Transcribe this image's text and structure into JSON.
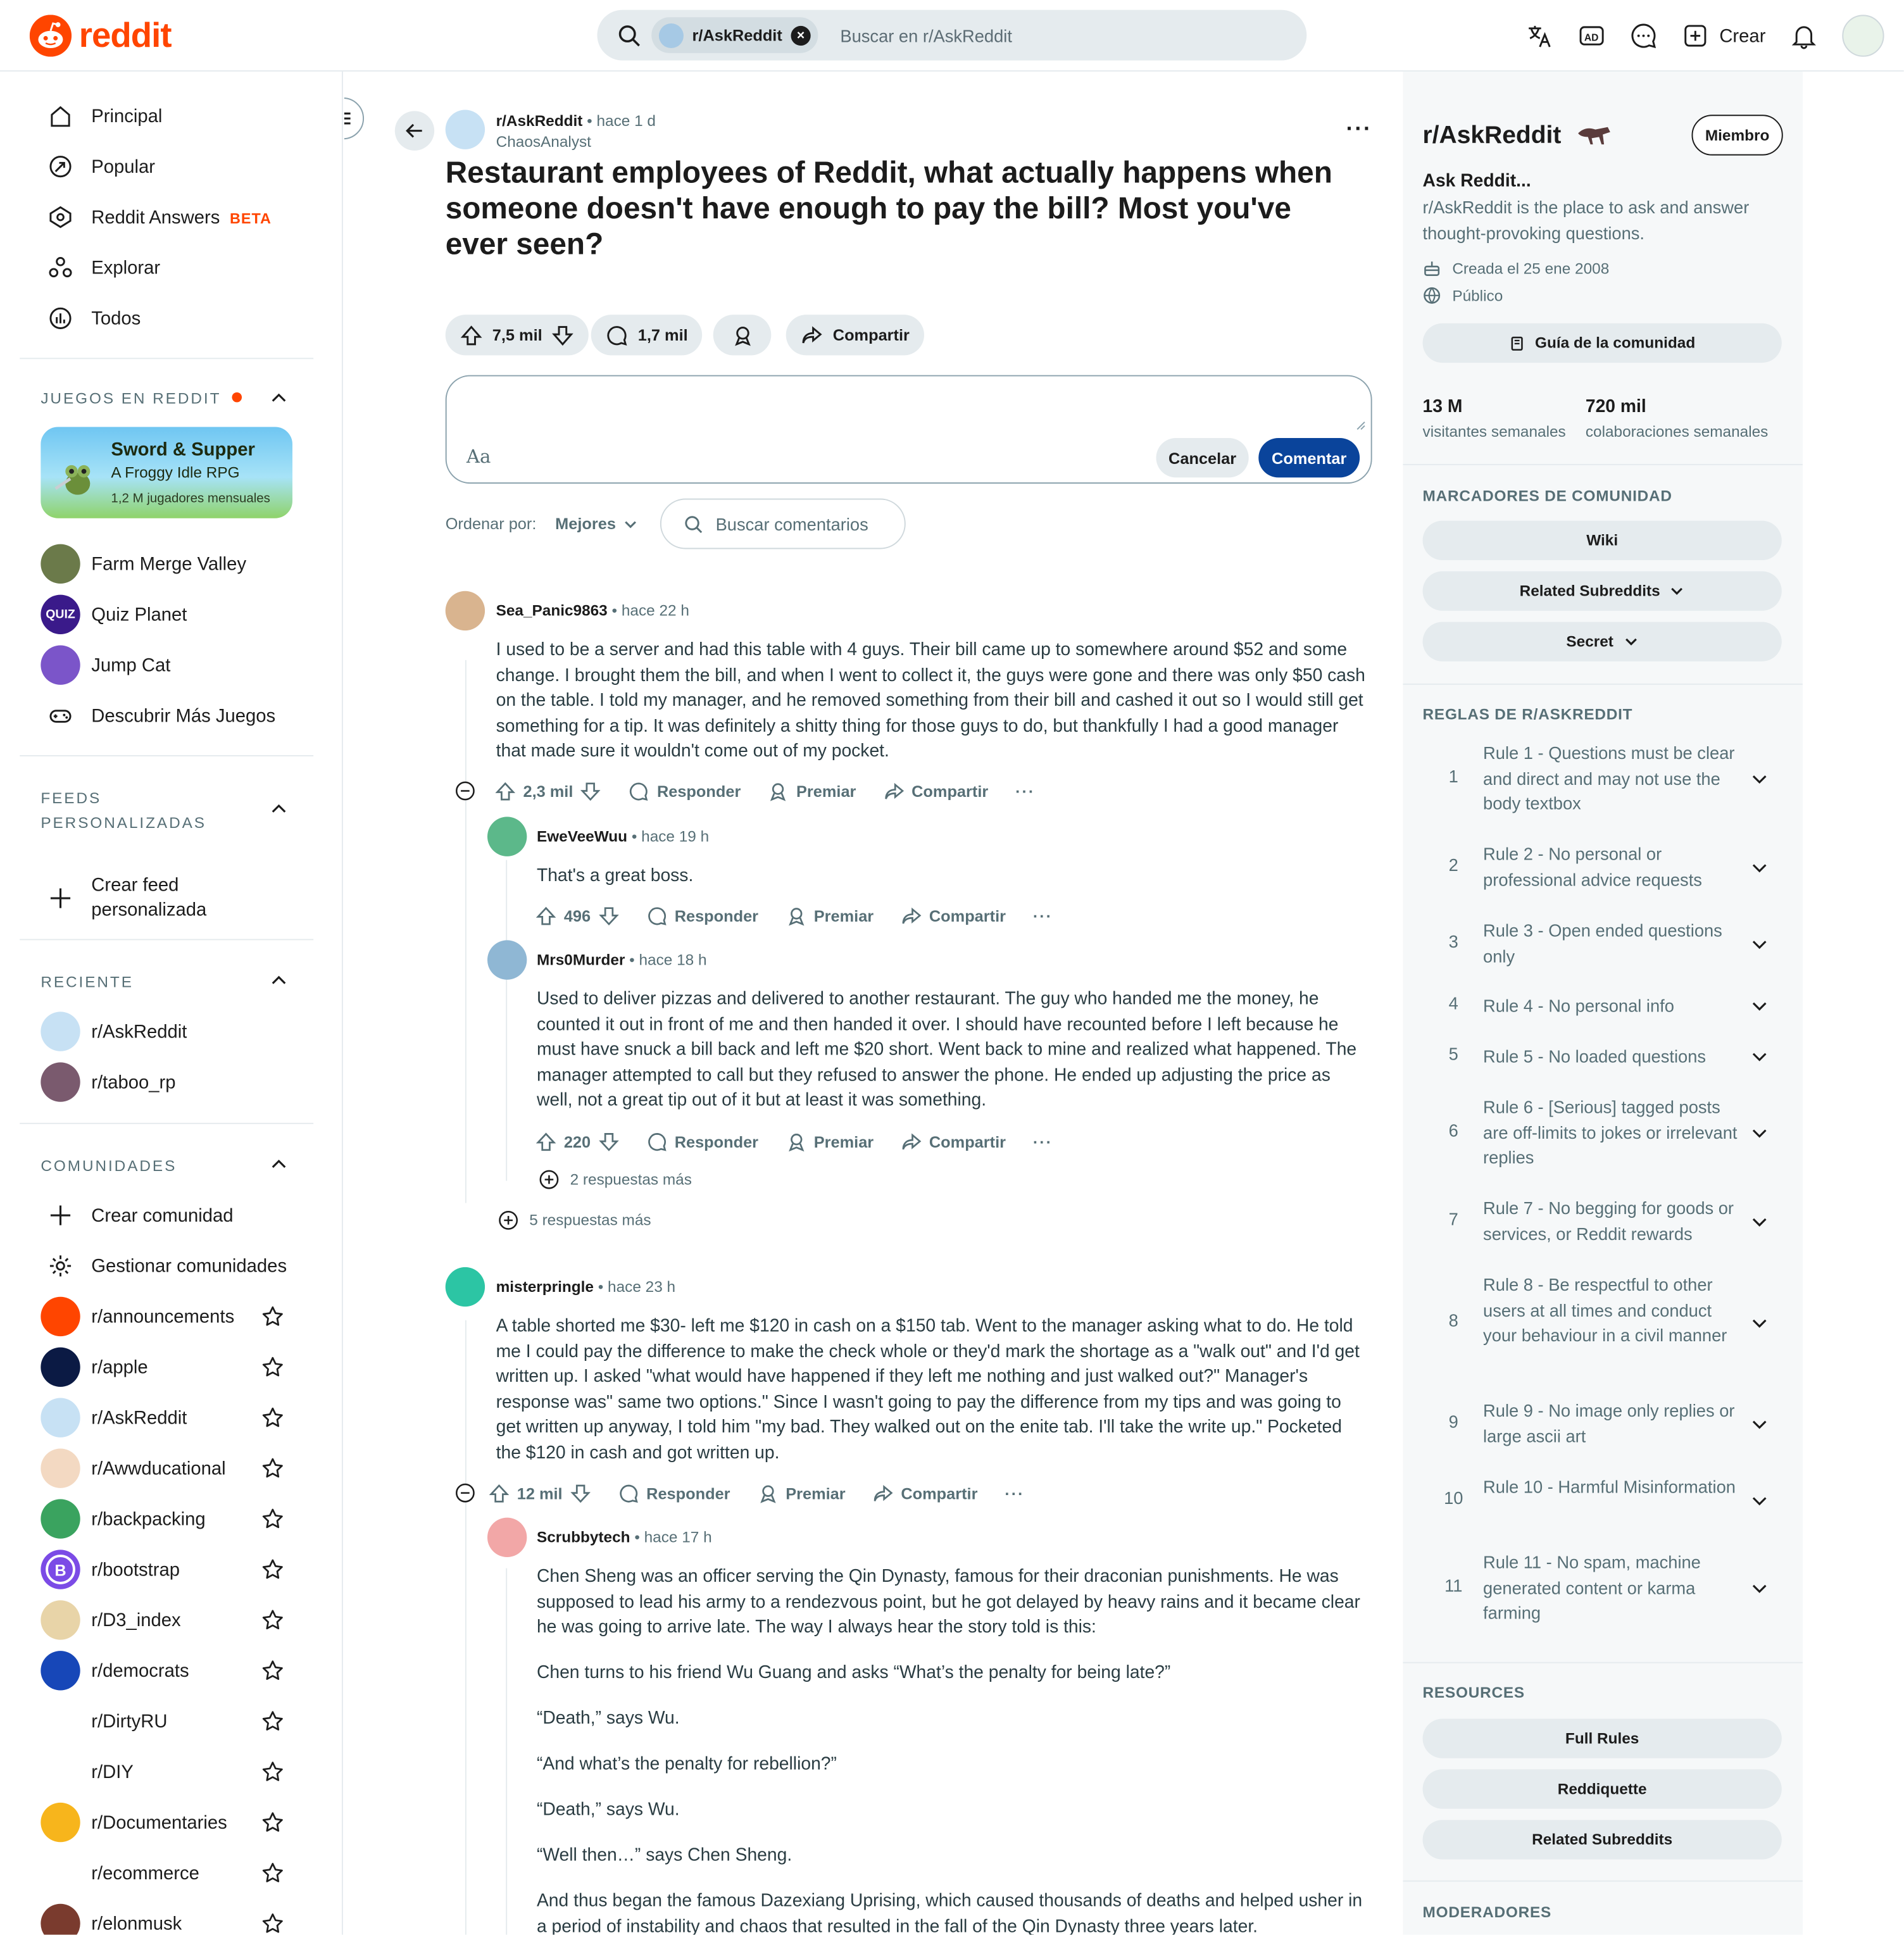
{
  "colors": {
    "brand": "#ff4500",
    "accent_button": "#0a449b",
    "pill_bg": "#e5ebee",
    "muted_text": "#576f76"
  },
  "header": {
    "logo_text": "reddit",
    "search_chip": "r/AskReddit",
    "search_placeholder": "Buscar en r/AskReddit",
    "icons": [
      "translate-icon",
      "advertise-icon",
      "chat-icon",
      "create-icon",
      "notifications-icon"
    ],
    "create_label": "Crear"
  },
  "sidebar": {
    "nav": [
      {
        "label": "Principal",
        "icon": "home-icon"
      },
      {
        "label": "Popular",
        "icon": "popular-icon"
      },
      {
        "label": "Reddit Answers",
        "icon": "answers-icon",
        "badge": "BETA"
      },
      {
        "label": "Explorar",
        "icon": "explore-icon"
      },
      {
        "label": "Todos",
        "icon": "all-icon"
      }
    ],
    "games_header": "JUEGOS EN REDDIT",
    "featured_game": {
      "title": "Sword & Supper",
      "subtitle": "A Froggy Idle RPG",
      "players": "1,2 M jugadores mensuales"
    },
    "games": [
      {
        "label": "Farm Merge Valley"
      },
      {
        "label": "Quiz Planet",
        "logo_text": "QUIZ"
      },
      {
        "label": "Jump Cat"
      },
      {
        "label": "Descubrir Más Juegos"
      }
    ],
    "feeds_header_line1": "FEEDS",
    "feeds_header_line2": "PERSONALIZADAS",
    "create_feed_line1": "Crear feed",
    "create_feed_line2": "personalizada",
    "recent_header": "RECIENTE",
    "recent": [
      {
        "label": "r/AskReddit",
        "color": "#c7e1f4"
      },
      {
        "label": "r/taboo_rp",
        "color": "#7a5a6e"
      }
    ],
    "communities_header": "COMUNIDADES",
    "create_community": "Crear comunidad",
    "manage_communities": "Gestionar comunidades",
    "communities": [
      {
        "label": "r/announcements",
        "color": "#ff4500"
      },
      {
        "label": "r/apple",
        "color": "#0b1a44"
      },
      {
        "label": "r/AskReddit",
        "color": "#c7e1f4"
      },
      {
        "label": "r/Awwducational",
        "color": "#f3d9c2"
      },
      {
        "label": "r/backpacking",
        "color": "#3aa35f"
      },
      {
        "label": "r/bootstrap",
        "color": "#7b4be6",
        "letter": "B"
      },
      {
        "label": "r/D3_index",
        "color": "#e8d4a8"
      },
      {
        "label": "r/democrats",
        "color": "#1747b8"
      },
      {
        "label": "r/DirtyRU",
        "color": "#ffffff"
      },
      {
        "label": "r/DIY",
        "color": "#ffffff"
      },
      {
        "label": "r/Documentaries",
        "color": "#f7b51c"
      },
      {
        "label": "r/ecommerce",
        "color": "#ffffff"
      },
      {
        "label": "r/elonmusk",
        "color": "#7a3b2e"
      }
    ]
  },
  "post": {
    "subreddit": "r/AskReddit",
    "time": "hace 1 d",
    "author": "ChaosAnalyst",
    "title": "Restaurant employees of Reddit, what actually happens when someone doesn't have enough to pay the bill? Most you've ever seen?",
    "votes": "7,5 mil",
    "comments": "1,7 mil",
    "share": "Compartir",
    "composer_aa": "Aa",
    "cancel": "Cancelar",
    "comment_btn": "Comentar",
    "sort_label": "Ordenar por:",
    "sort_value": "Mejores",
    "search_comments": "Buscar comentarios"
  },
  "comments": [
    {
      "author": "Sea_Panic9863",
      "time": "hace 22 h",
      "avatar_color": "#d9b48f",
      "body": [
        "I used to be a server and had this table with 4 guys. Their bill came up to somewhere around $52 and some change. I brought them the bill, and when I went to collect it, the guys were gone and there was only $50 cash on the table. I told my manager, and he removed something from their bill and cashed it out so I would still get something for a tip. It was definitely a shitty thing for those guys to do, but thankfully I had a good manager that made sure it wouldn't come out of my pocket."
      ],
      "votes": "2,3 mil"
    },
    {
      "author": "EweVeeWuu",
      "time": "hace 19 h",
      "avatar_color": "#5cb88a",
      "body": [
        "That's a great boss."
      ],
      "votes": "496"
    },
    {
      "author": "Mrs0Murder",
      "time": "hace 18 h",
      "avatar_color": "#8fb7d4",
      "body": [
        "Used to deliver pizzas and delivered to another restaurant. The guy who handed me the money, he counted it out in front of me and then handed it over. I should have recounted before I left because he must have snuck a bill back and left me $20 short. Went back to mine and realized what happened. The manager attempted to call but they refused to answer the phone. He ended up adjusting the price as well, not a great tip out of it but at least it was something."
      ],
      "votes": "220"
    },
    {
      "author": "misterpringle",
      "time": "hace 23 h",
      "avatar_color": "#2cc5a4",
      "body": [
        "A table shorted me $30- left me $120 in cash on a $150 tab. Went to the manager asking what to do. He told me I could pay the difference to make the check whole or they'd mark the shortage as a \"walk out\" and I'd get written up. I asked \"what would have happened if they left me nothing and just walked out?\" Manager's response was\" same two options.\" Since I wasn't going to pay the difference from my tips and was going to get written up anyway, I told him \"my bad. They walked out on the enite tab. I'll take the write up.\" Pocketed the $120 in cash and got written up."
      ],
      "votes": "12 mil"
    },
    {
      "author": "Scrubbytech",
      "time": "hace 17 h",
      "avatar_color": "#f2a7a7",
      "body": [
        "Chen Sheng was an officer serving the Qin Dynasty, famous for their draconian punishments. He was supposed to lead his army to a rendezvous point, but he got delayed by heavy rains and it became clear he was going to arrive late. The way I always hear the story told is this:",
        "Chen turns to his friend Wu Guang and asks “What’s the penalty for being late?”",
        "“Death,” says Wu.",
        "“And what’s the penalty for rebellion?”",
        "“Death,” says Wu.",
        "“Well then…” says Chen Sheng.",
        "And thus began the famous Dazexiang Uprising, which caused thousands of deaths and helped usher in a period of instability and chaos that resulted in the fall of the Qin Dynasty three years later."
      ]
    }
  ],
  "action_labels": {
    "reply": "Responder",
    "award": "Premiar",
    "share": "Compartir"
  },
  "more_replies": {
    "inner": "2 respuestas más",
    "outer": "5 respuestas más"
  },
  "right": {
    "title": "r/AskReddit",
    "member_btn": "Miembro",
    "subtitle": "Ask Reddit...",
    "description": "r/AskReddit is the place to ask and answer thought-provoking questions.",
    "created": "Creada el 25 ene 2008",
    "visibility": "Público",
    "guide_btn": "Guía de la comunidad",
    "stat1_value": "13 M",
    "stat1_label": "visitantes semanales",
    "stat2_value": "720 mil",
    "stat2_label": "colaboraciones semanales",
    "bookmarks_header": "MARCADORES DE COMUNIDAD",
    "bookmarks": [
      "Wiki",
      "Related Subreddits",
      "Secret"
    ],
    "rules_header": "REGLAS DE R/ASKREDDIT",
    "rules": [
      {
        "n": "1",
        "text": "Rule 1 - Questions must be clear and direct and may not use the body textbox"
      },
      {
        "n": "2",
        "text": "Rule 2 - No personal or professional advice requests"
      },
      {
        "n": "3",
        "text": "Rule 3 - Open ended questions only"
      },
      {
        "n": "4",
        "text": "Rule 4 - No personal info"
      },
      {
        "n": "5",
        "text": "Rule 5 - No loaded questions"
      },
      {
        "n": "6",
        "text": "Rule 6 - [Serious] tagged posts are off-limits to jokes or irrelevant replies"
      },
      {
        "n": "7",
        "text": "Rule 7 - No begging for goods or services, or Reddit rewards"
      },
      {
        "n": "8",
        "text": "Rule 8 - Be respectful to other users at all times and conduct your behaviour in a civil manner"
      },
      {
        "n": "9",
        "text": "Rule 9 - No image only replies or large ascii art"
      },
      {
        "n": "10",
        "text": "Rule 10 - Harmful Misinformation"
      },
      {
        "n": "11",
        "text": "Rule 11 - No spam, machine generated content or karma farming"
      }
    ],
    "resources_header": "RESOURCES",
    "resources": [
      "Full Rules",
      "Reddiquette",
      "Related Subreddits"
    ],
    "moderators_header": "MODERADORES"
  }
}
